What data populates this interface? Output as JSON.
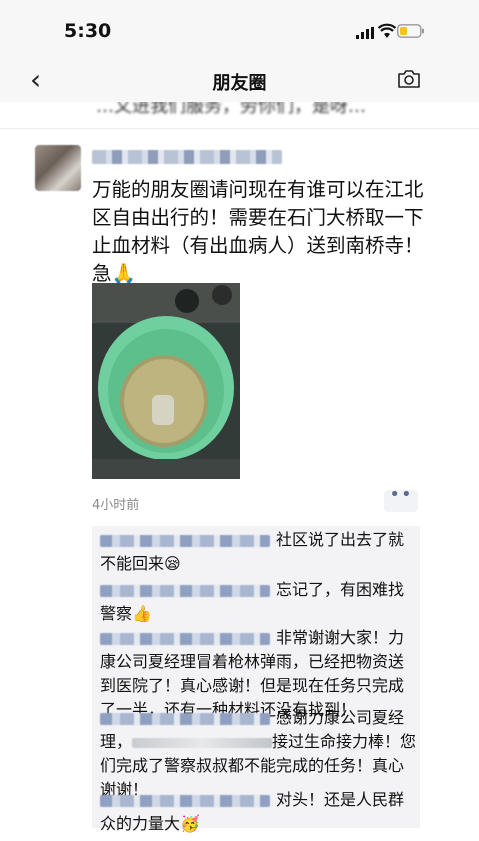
{
  "status_bar": {
    "time": "5:30"
  },
  "nav": {
    "title": "朋友圈"
  },
  "previous_post_tail": "…又进我们服务，劳你们，是呀…",
  "post": {
    "text": "万能的朋友圈请问现在有谁可以在江北区自由出行的！需要在石门大桥取一下止血材料（有出血病人）送到南桥寺！急🙏",
    "time_ago": "4小时前",
    "more_label": "••"
  },
  "comments": [
    {
      "text": "社区说了出去了就不能回来😪"
    },
    {
      "text": "忘记了，有困难找警察👍"
    },
    {
      "text": "非常谢谢大家！力康公司夏经理冒着枪林弹雨，已经把物资送到医院了！真心感谢！但是现在任务只完成了一半，还有一种材料还没有找到！"
    },
    {
      "text_a": "感谢力康公司夏经理，",
      "text_b": "接过生命接力棒！您们完成了警察叔叔都不能完成的任务！真心谢谢！"
    },
    {
      "text": "对头！还是人民群众的力量大🥳"
    }
  ],
  "colors": {
    "link_blue": "#5b6b92",
    "comment_bg": "#f3f3f5",
    "bar_bg": "#f7f7f7"
  }
}
